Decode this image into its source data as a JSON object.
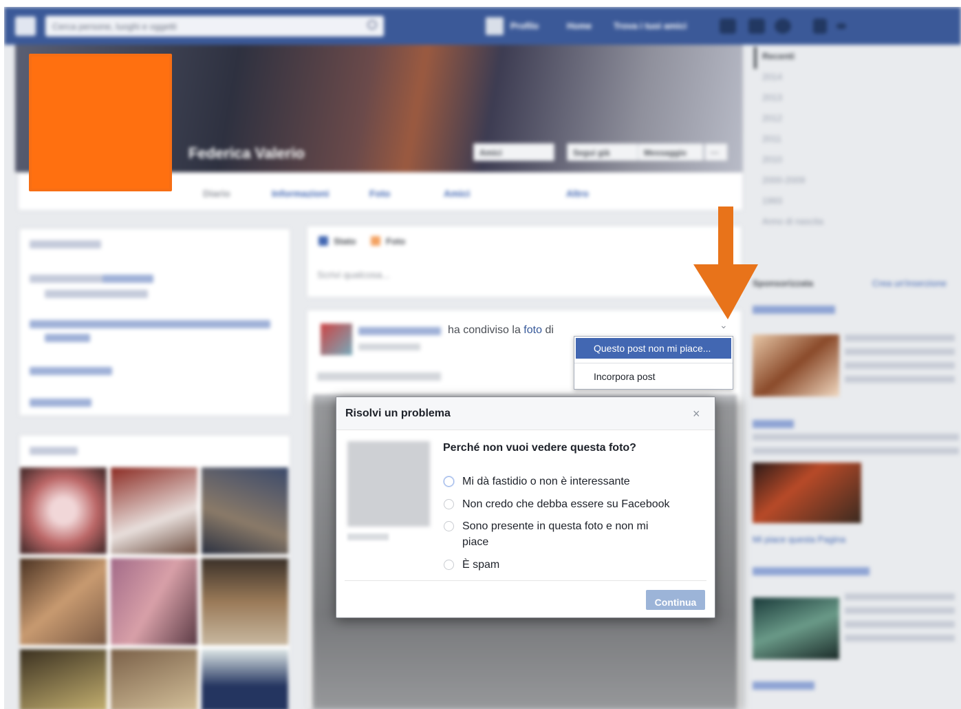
{
  "topbar": {
    "search_placeholder": "Cerca persone, luoghi e oggetti",
    "nav_profile": "Profilo",
    "nav_home": "Home",
    "nav_find_friends": "Trova i tuoi amici"
  },
  "profile": {
    "name": "Federica Valerio",
    "btn_friends": "Amici",
    "btn_follow": "Segui già",
    "btn_message": "Messaggio",
    "btn_more": "···",
    "tabs": [
      "Diario",
      "Informazioni",
      "Foto",
      "Amici",
      "Altro"
    ]
  },
  "composer": {
    "tab_status": "Stato",
    "tab_photo": "Foto",
    "placeholder": "Scrivi qualcosa..."
  },
  "post": {
    "shared_text": "ha condiviso la",
    "photo_link": "foto",
    "of_text": "di"
  },
  "post_menu": {
    "item_dislike": "Questo post non mi piace...",
    "item_embed": "Incorpora post"
  },
  "dialog": {
    "title": "Risolvi un problema",
    "close": "×",
    "question": "Perché non vuoi vedere questa foto?",
    "options": [
      "Mi dà fastidio o non è interessante",
      "Non credo che debba essere su Facebook",
      "Sono presente in questa foto e non mi piace",
      "È spam"
    ],
    "continue_label": "Continua"
  },
  "timeline": {
    "label": "Recenti",
    "years": [
      "2014",
      "2013",
      "2012",
      "2011",
      "2010",
      "2000-2009",
      "1993",
      "Anno di nascita"
    ]
  },
  "ads": {
    "label": "Sponsorizzata",
    "create_ad": "Crea un'inserzione",
    "like_page": "Mi piace questa Pagina"
  },
  "colors": {
    "facebook_blue": "#3b5998",
    "highlight": "#4267b2",
    "annotation_arrow": "#e8731a",
    "profile_pic": "#ff7010"
  }
}
